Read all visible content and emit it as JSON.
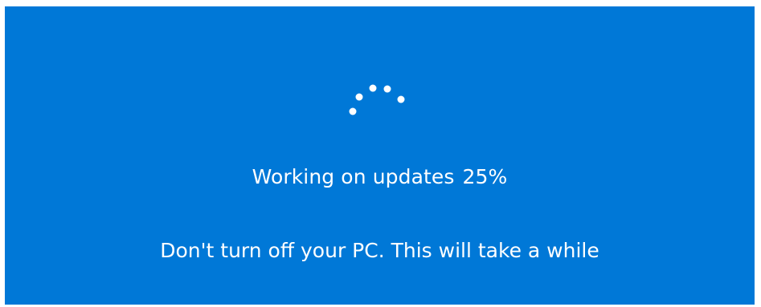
{
  "screen": {
    "background_color": "#0078d7",
    "text_color": "#ffffff"
  },
  "spinner": {
    "icon": "loading-dots-icon",
    "dot_count": 5
  },
  "status": {
    "message": "Working on updates",
    "progress_text": "25%",
    "progress_percent": 25
  },
  "warning": {
    "message": "Don't turn off your PC. This will take a while"
  }
}
